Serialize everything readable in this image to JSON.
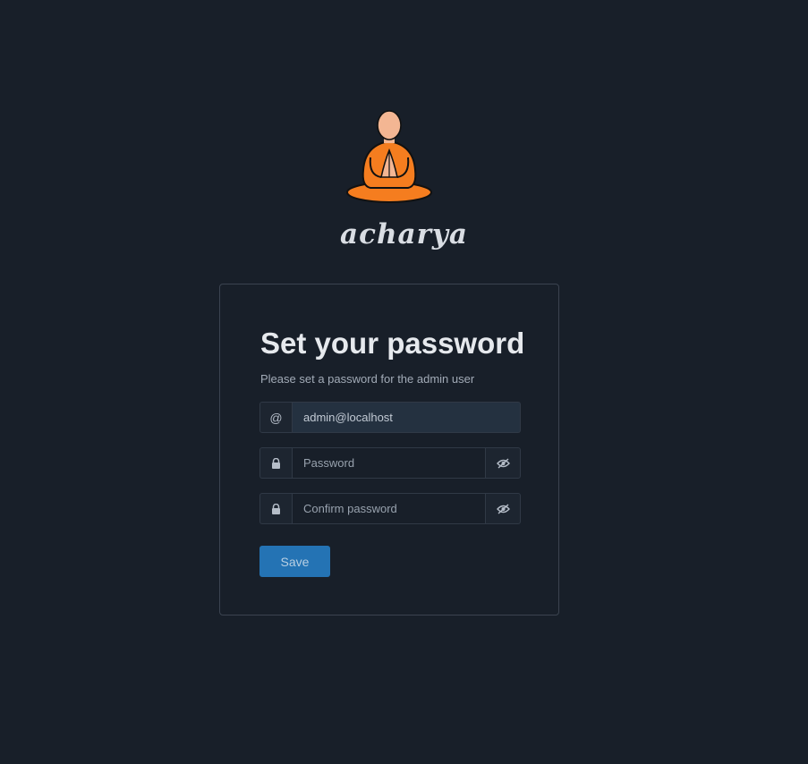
{
  "brand": {
    "name": "acharya",
    "logo": "meditating-monk-logo"
  },
  "form": {
    "title": "Set your password",
    "subtitle": "Please set a password for the admin user",
    "email": {
      "icon_text": "@",
      "value": "admin@localhost"
    },
    "password": {
      "placeholder": "Password",
      "icon": "lock-icon",
      "toggle_icon": "eye-slash-icon"
    },
    "confirm_password": {
      "placeholder": "Confirm password",
      "icon": "lock-icon",
      "toggle_icon": "eye-slash-icon"
    },
    "save_label": "Save"
  },
  "colors": {
    "background": "#181f29",
    "accent": "#2473b4",
    "robe": "#f57d1f",
    "skin": "#f3b693"
  }
}
